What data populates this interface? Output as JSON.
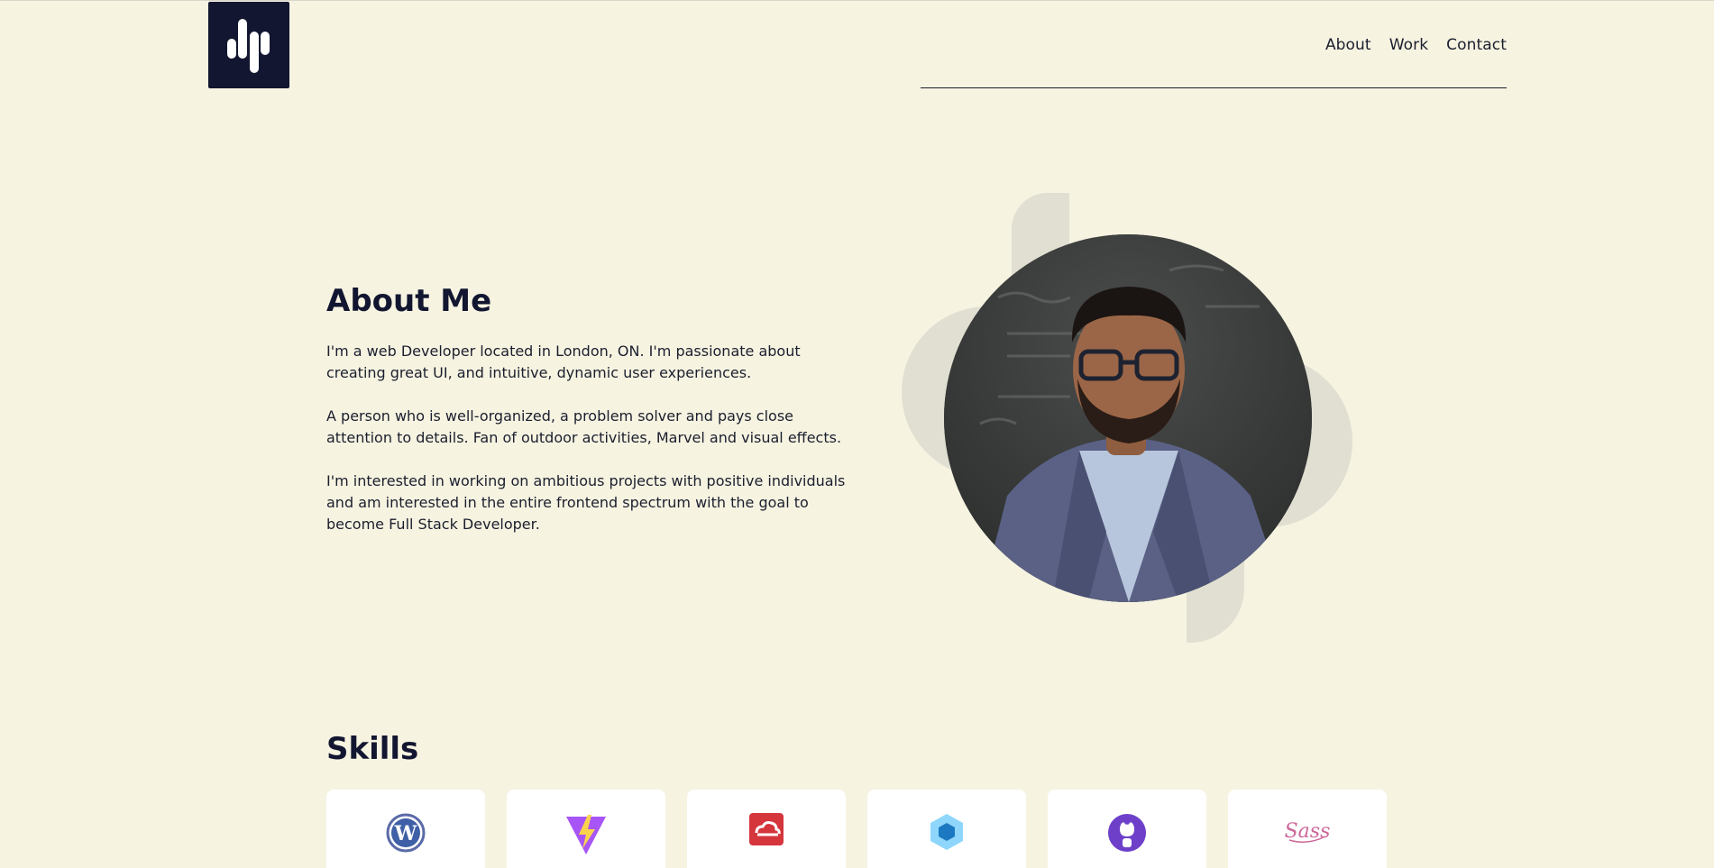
{
  "brand": {
    "logo_icon": "dp-logo-icon"
  },
  "nav": {
    "links": [
      {
        "label": "About"
      },
      {
        "label": "Work"
      },
      {
        "label": "Contact"
      }
    ]
  },
  "about": {
    "title": "About Me",
    "paragraphs": [
      "I'm a web Developer located in London, ON. I'm passionate about creating great UI, and intuitive, dynamic user experiences.",
      "A person who is well-organized, a problem solver and pays close attention to details. Fan of outdoor activities, Marvel and visual effects.",
      "I'm interested in working on ambitious projects with positive individuals and am interested in the entire frontend spectrum with the goal to become Full Stack Developer."
    ],
    "photo_icon": "profile-photo"
  },
  "skills": {
    "title": "Skills",
    "items": [
      {
        "icon": "wordpress-icon",
        "color": "#21759b"
      },
      {
        "icon": "vite-icon",
        "color": "#a855f7"
      },
      {
        "icon": "adobe-creative-cloud-icon",
        "color": "#d4363c"
      },
      {
        "icon": "webpack-icon",
        "color": "#8ed6fb"
      },
      {
        "icon": "github-icon",
        "color": "#6e40c9"
      },
      {
        "icon": "sass-icon",
        "color": "#cd6799"
      }
    ]
  },
  "colors": {
    "background": "#f6f3e1",
    "navy": "#121630",
    "decor": "#e1dfd1"
  }
}
